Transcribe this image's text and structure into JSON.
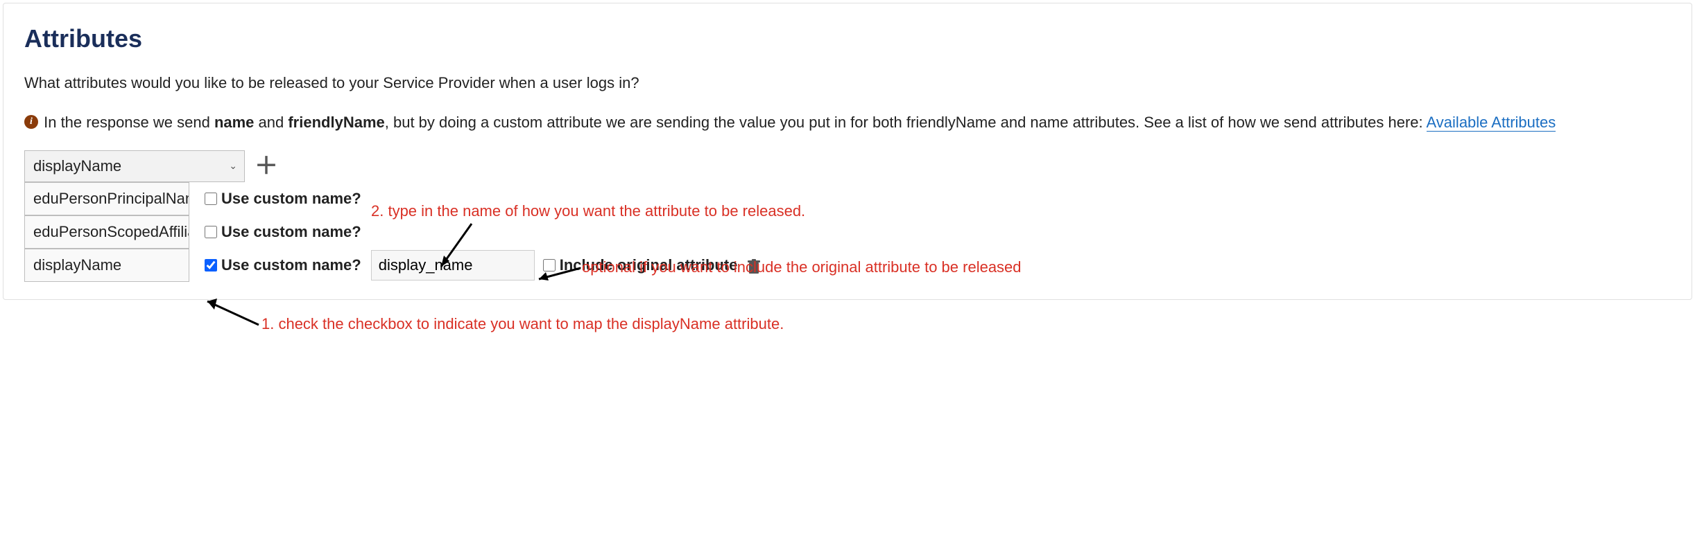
{
  "title": "Attributes",
  "description": "What attributes would you like to be released to your Service Provider when a user logs in?",
  "info": {
    "prefix": " In the response we send ",
    "name": "name",
    "and": " and ",
    "friendly": "friendlyName",
    "rest": ", but by doing a custom attribute we are sending the value you put in for both friendlyName and name attributes. See a list of how we send attributes here: ",
    "link": "Available Attributes"
  },
  "select": {
    "value": "displayName"
  },
  "rows": [
    {
      "attr": "eduPersonPrincipalName",
      "custom_label": "Use custom name?",
      "checked": false
    },
    {
      "attr": "eduPersonScopedAffiliation",
      "custom_label": "Use custom name?",
      "checked": false
    },
    {
      "attr": "displayName",
      "custom_label": "Use custom name?",
      "checked": true,
      "custom_value": "display_name",
      "include_label": "Include original attribute"
    }
  ],
  "annotations": {
    "a2": "2. type in the name of how you want the attribute to be released.",
    "a_opt": "optional if you want to include the original attribute to be released",
    "a1": "1. check the checkbox to  indicate you want to map the displayName attribute."
  }
}
